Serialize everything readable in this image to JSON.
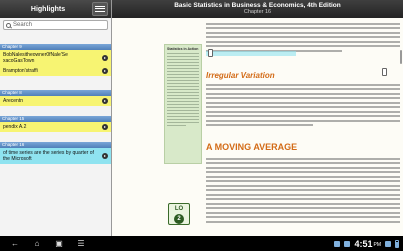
{
  "panel": {
    "title": "Highlights",
    "search_placeholder": "Search",
    "groups": [
      {
        "chapter": "Chapter 9",
        "items": [
          {
            "text": "BobNalesitheowner0fNale'Se xacoGasTown",
            "color": "yellow"
          },
          {
            "text": "Brampton'straffi",
            "color": "yellow"
          }
        ]
      },
      {
        "chapter": "Chapter 8",
        "items": [
          {
            "text": "Arecentn",
            "color": "yellow"
          }
        ]
      },
      {
        "chapter": "Chapter 15",
        "items": [
          {
            "text": "pendix A.2",
            "color": "yellow"
          }
        ]
      },
      {
        "chapter": "Chapter 16",
        "items": [
          {
            "text": "of time series are the series by quarter of the Microsoft",
            "color": "cyan"
          }
        ]
      }
    ]
  },
  "book": {
    "title": "Basic Statistics in Business & Economics, 4th Edition",
    "chapter": "Chapter 16",
    "stats_box_title": "Statistics in Action",
    "heading_irregular": "Irregular Variation",
    "heading_moving_average": "A MOVING AVERAGE",
    "icon_label": "LO",
    "icon_number": "2"
  },
  "system": {
    "time": "4:51",
    "ampm": "PM"
  },
  "colors": {
    "highlight_yellow": "#f7f472",
    "highlight_cyan": "#8fe3f0",
    "heading_orange": "#d36b17",
    "chapter_blue": "#4f7fb9"
  }
}
